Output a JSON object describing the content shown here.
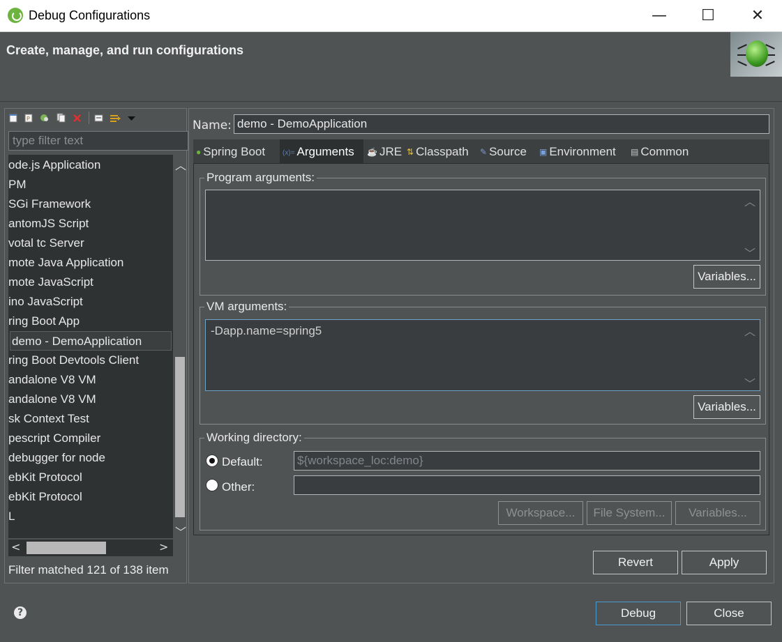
{
  "window": {
    "title": "Debug Configurations",
    "minimize": "—",
    "maximize": "☐",
    "close": "✕"
  },
  "header": {
    "title": "Create, manage, and run configurations"
  },
  "left": {
    "filter_placeholder": "type filter text",
    "items": [
      "ode.js Application",
      "PM",
      "SGi Framework",
      "antomJS Script",
      "votal tc Server",
      "mote Java Application",
      "mote JavaScript",
      "ino JavaScript",
      "ring Boot App",
      "demo - DemoApplication",
      "ring Boot Devtools Client",
      "andalone V8 VM",
      "andalone V8 VM",
      "sk Context Test",
      "pescript Compiler",
      " debugger for node",
      "ebKit Protocol",
      "ebKit Protocol",
      "L"
    ],
    "selected_index": 9,
    "status": "Filter matched 121 of 138 item"
  },
  "right": {
    "name_label": "Name:",
    "name_value": "demo - DemoApplication",
    "tabs": [
      {
        "label": "Spring Boot",
        "icon": "spring-boot-icon"
      },
      {
        "label": "Arguments",
        "icon": "arguments-icon"
      },
      {
        "label": "JRE",
        "icon": "jre-icon"
      },
      {
        "label": "Classpath",
        "icon": "classpath-icon"
      },
      {
        "label": "Source",
        "icon": "source-icon"
      },
      {
        "label": "Environment",
        "icon": "environment-icon"
      },
      {
        "label": "Common",
        "icon": "common-icon"
      }
    ],
    "active_tab": "Arguments",
    "program_args": {
      "label": "Program arguments:",
      "value": "",
      "variables": "Variables..."
    },
    "vm_args": {
      "label": "VM arguments:",
      "value": "-Dapp.name=spring5",
      "variables": "Variables..."
    },
    "working_dir": {
      "label": "Working directory:",
      "default_label": "Default:",
      "default_value": "${workspace_loc:demo}",
      "other_label": "Other:",
      "other_value": "",
      "workspace": "Workspace...",
      "file_system": "File System...",
      "variables": "Variables..."
    },
    "revert": "Revert",
    "apply": "Apply"
  },
  "footer": {
    "help": "?",
    "debug": "Debug",
    "close": "Close"
  }
}
